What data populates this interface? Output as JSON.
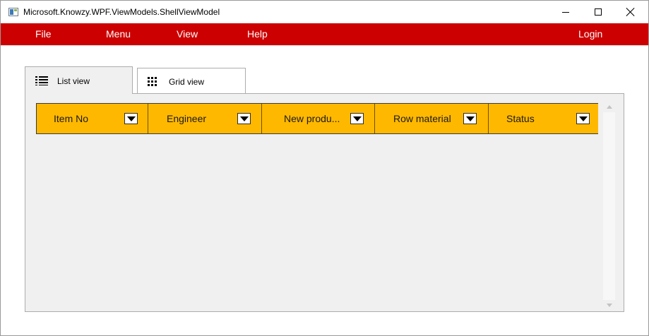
{
  "window": {
    "title": "Microsoft.Knowzy.WPF.ViewModels.ShellViewModel",
    "icon": "app-window-icon",
    "controls": [
      "minimize-icon",
      "maximize-icon",
      "close-icon"
    ]
  },
  "menu": {
    "items": [
      {
        "label": "File"
      },
      {
        "label": "Menu"
      },
      {
        "label": "View"
      },
      {
        "label": "Help"
      }
    ],
    "login_label": "Login",
    "background": "#cc0000",
    "text_color": "#ffffff"
  },
  "tabs": [
    {
      "label": "List view",
      "icon": "list-icon",
      "selected": true
    },
    {
      "label": "Grid view",
      "icon": "grid-icon",
      "selected": false
    }
  ],
  "grid": {
    "header_color": "#ffb800",
    "columns": [
      {
        "label": "Item No",
        "icon": "dropdown-arrow-icon"
      },
      {
        "label": "Engineer",
        "icon": "dropdown-arrow-icon"
      },
      {
        "label": "New produ...",
        "icon": "dropdown-arrow-icon"
      },
      {
        "label": "Row material",
        "icon": "dropdown-arrow-icon"
      },
      {
        "label": "Status",
        "icon": "dropdown-arrow-icon"
      }
    ],
    "rows": []
  }
}
